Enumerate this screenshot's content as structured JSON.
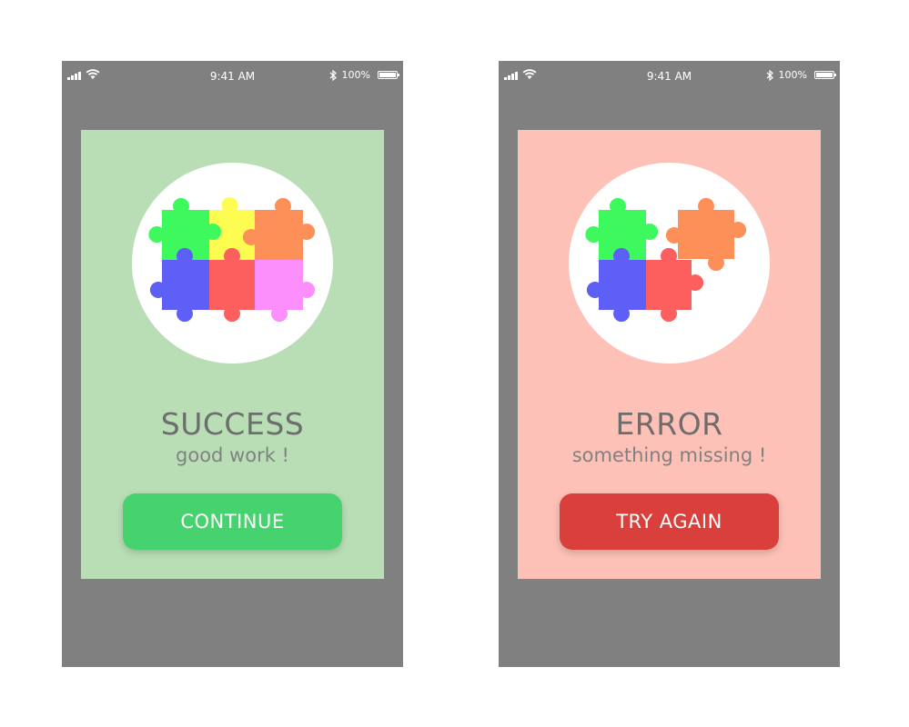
{
  "screens": [
    {
      "status": {
        "time": "9:41 AM",
        "battery": "100%"
      },
      "title": "SUCCESS",
      "subtitle": "good work !",
      "button": "CONTINUE",
      "colors": {
        "card": "#b9deb6",
        "button": "#46d26e"
      }
    },
    {
      "status": {
        "time": "9:41 AM",
        "battery": "100%"
      },
      "title": "ERROR",
      "subtitle": "something missing !",
      "button": "TRY AGAIN",
      "colors": {
        "card": "#fdc1b7",
        "button": "#d9403b"
      }
    }
  ],
  "puzzle_colors": {
    "green": "#3ef95e",
    "yellow": "#fdfc51",
    "orange": "#fd8f58",
    "blue": "#5d5ff6",
    "red": "#fd5f5e",
    "pink": "#fd8ffd"
  },
  "icons": {
    "signal": "signal-bars-icon",
    "wifi": "wifi-icon",
    "bluetooth": "bluetooth-icon",
    "battery": "battery-icon",
    "illustration": "puzzle-pieces-icon"
  }
}
